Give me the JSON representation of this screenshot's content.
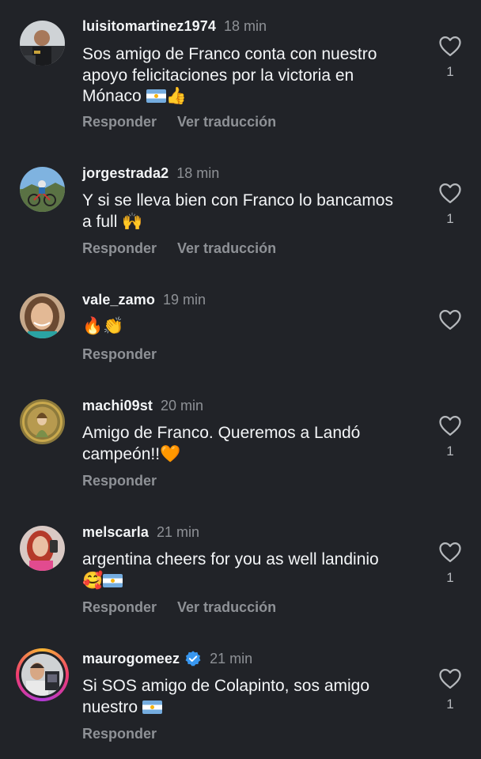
{
  "comments": [
    {
      "username": "luisitomartinez1974",
      "time": "18 min",
      "text": "Sos amigo de Franco conta con nuestro\napoyo felicitaciones por la victoria en\nMónaco ",
      "emoji": "👍",
      "likes": "1",
      "reply_label": "Responder",
      "translate_label": "Ver traducción"
    },
    {
      "username": "jorgestrada2",
      "time": "18 min",
      "text": "Y si se lleva bien con Franco lo bancamos\na full ",
      "emoji": "🙌",
      "likes": "1",
      "reply_label": "Responder",
      "translate_label": "Ver traducción"
    },
    {
      "username": "vale_zamo",
      "time": "19 min",
      "text": "🔥👏",
      "reply_label": "Responder"
    },
    {
      "username": "machi09st",
      "time": "20 min",
      "text": "Amigo de Franco. Queremos a Landó\ncampeón!!🧡",
      "likes": "1",
      "reply_label": "Responder"
    },
    {
      "username": "melscarla",
      "time": "21 min",
      "text": "argentina cheers for you as well landinio\n🥰",
      "likes": "1",
      "reply_label": "Responder",
      "translate_label": "Ver traducción"
    },
    {
      "username": "maurogomeez",
      "verified": true,
      "time": "21 min",
      "text": "Si SOS amigo de Colapinto, sos amigo\nnuestro ",
      "likes": "1",
      "reply_label": "Responder"
    }
  ],
  "colors": {
    "background": "#212328",
    "primary_text": "#f3f5f7",
    "secondary_text": "#8e9196",
    "verified_badge": "#3897f0"
  },
  "icons": {
    "like": "heart-outline-icon",
    "verified": "verified-badge-icon",
    "flag": "argentina-flag-icon"
  }
}
